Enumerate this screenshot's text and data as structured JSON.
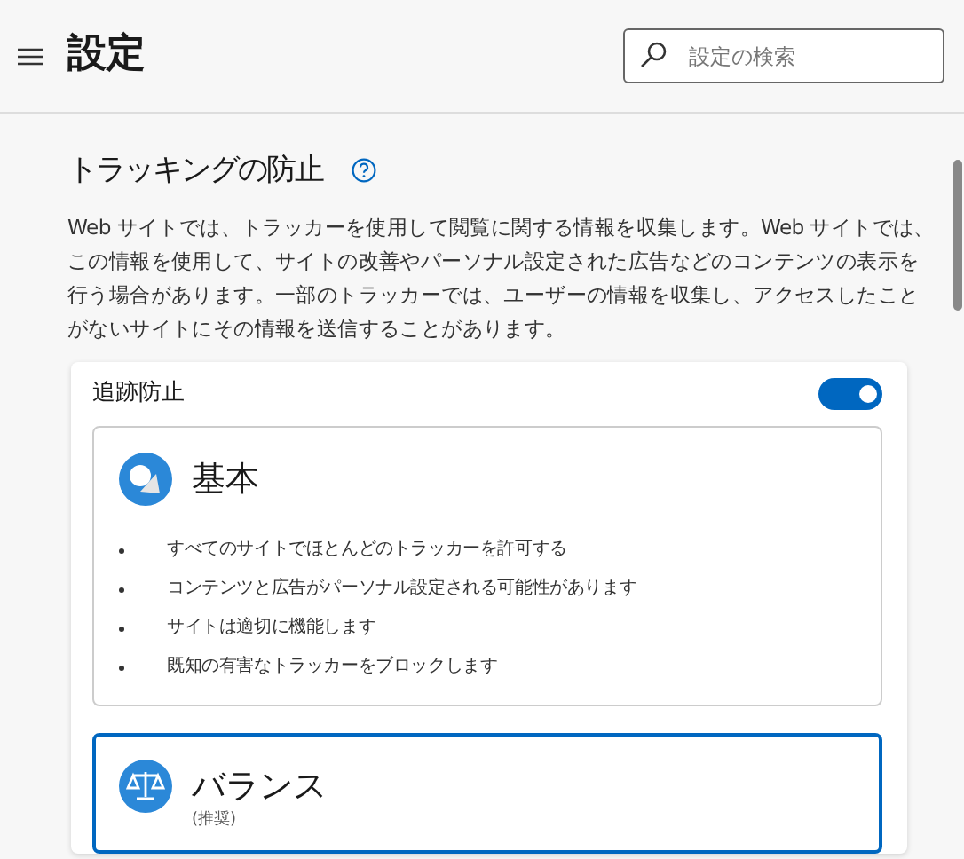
{
  "header": {
    "title": "設定",
    "search": {
      "placeholder": "設定の検索"
    }
  },
  "section": {
    "title": "トラッキングの防止",
    "description": "Web サイトでは、トラッカーを使用して閲覧に関する情報を収集します。Web サイトでは、この情報を使用して、サイトの改善やパーソナル設定された広告などのコンテンツの表示を行う場合があります。一部のトラッカーでは、ユーザーの情報を収集し、アクセスしたことがないサイトにその情報を送信することがあります。"
  },
  "tracking": {
    "label": "追跡防止",
    "on": true,
    "options": [
      {
        "kind": "basic",
        "title": "基本",
        "selected": false,
        "bullets": [
          "すべてのサイトでほとんどのトラッカーを許可する",
          "コンテンツと広告がパーソナル設定される可能性があります",
          "サイトは適切に機能します",
          "既知の有害なトラッカーをブロックします"
        ]
      },
      {
        "kind": "balanced",
        "title": "バランス",
        "subtitle": "(推奨)",
        "selected": true
      }
    ]
  }
}
